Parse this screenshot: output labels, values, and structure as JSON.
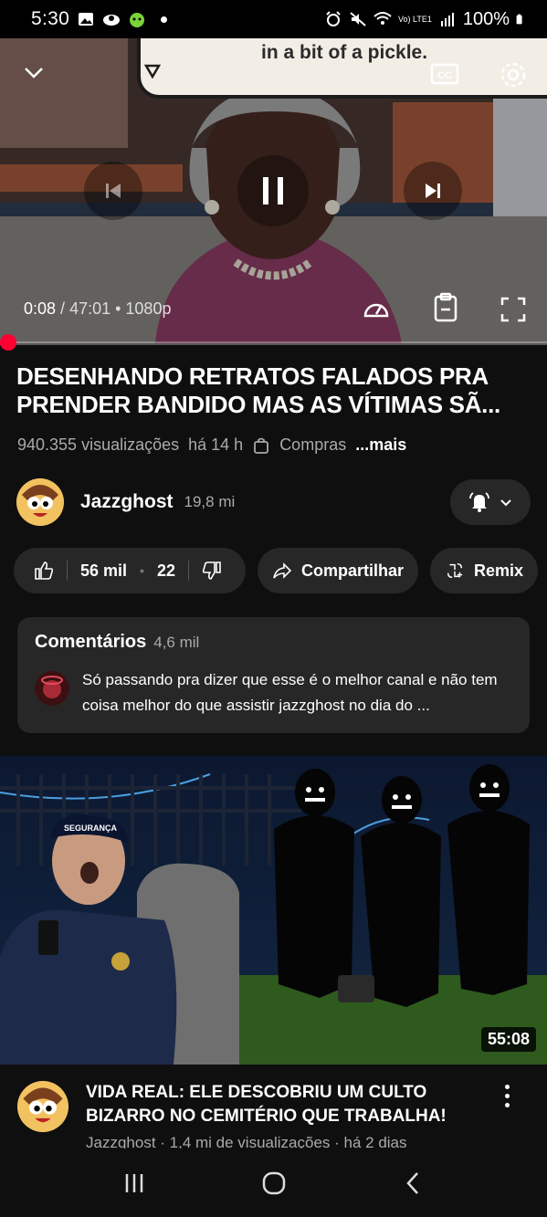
{
  "status_bar": {
    "time": "5:30",
    "battery": "100%",
    "network": "Vo) LTE1"
  },
  "player": {
    "caption": "in a bit of a pickle.",
    "current_time": "0:08",
    "separator": "/",
    "duration": "47:01",
    "quality": "• 1080p",
    "progress_fraction": 0.003,
    "icons": [
      "chevron-down-icon",
      "captions-icon",
      "settings-icon",
      "previous-icon",
      "pause-icon",
      "next-icon",
      "speed-icon",
      "clipboard-icon",
      "fullscreen-icon"
    ]
  },
  "video": {
    "title": "DESENHANDO RETRATOS FALADOS PRA PRENDER BANDIDO MAS AS VÍTIMAS SÃ...",
    "views": "940.355 visualizações",
    "age": "há 14 h",
    "shopping": "Compras",
    "more": "...mais"
  },
  "channel": {
    "name": "Jazzghost",
    "subscribers": "19,8 mi"
  },
  "actions": {
    "likes": "56 mil",
    "dislike_count": "22",
    "share": "Compartilhar",
    "remix": "Remix"
  },
  "comments": {
    "heading": "Comentários",
    "count": "4,6 mil",
    "top_comment": "Só passando pra dizer que esse é o melhor canal e não tem coisa melhor do que assistir jazzghost no dia do ..."
  },
  "next_video": {
    "duration": "55:08",
    "title": "VIDA REAL: ELE DESCOBRIU UM CULTO BIZARRO NO CEMITÉRIO QUE TRABALHA!",
    "meta": "Jazzghost · 1,4 mi de visualizações · há 2 dias",
    "thumb_badge": "SEGURANÇA"
  },
  "colors": {
    "accent": "#ff0033",
    "background": "#0f0f0f",
    "surface": "#272727"
  }
}
